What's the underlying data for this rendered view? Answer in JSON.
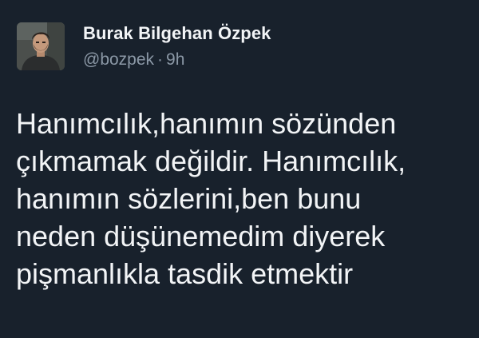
{
  "tweet": {
    "author": {
      "display_name": "Burak Bilgehan Özpek",
      "handle": "@bozpek",
      "avatar_icon": "profile-photo"
    },
    "time_separator": "·",
    "time_ago": "9h",
    "text": "Hanımcılık,hanımın sözünden\nçıkmamak değildir. Hanımcılık,\nhanımın sözlerini,ben bunu\nneden düşünemedim diyerek\npişmanlıkla tasdik etmektir"
  },
  "colors": {
    "background": "#18212c",
    "primary_text": "#f2f4f6",
    "secondary_text": "#8b98a6"
  }
}
